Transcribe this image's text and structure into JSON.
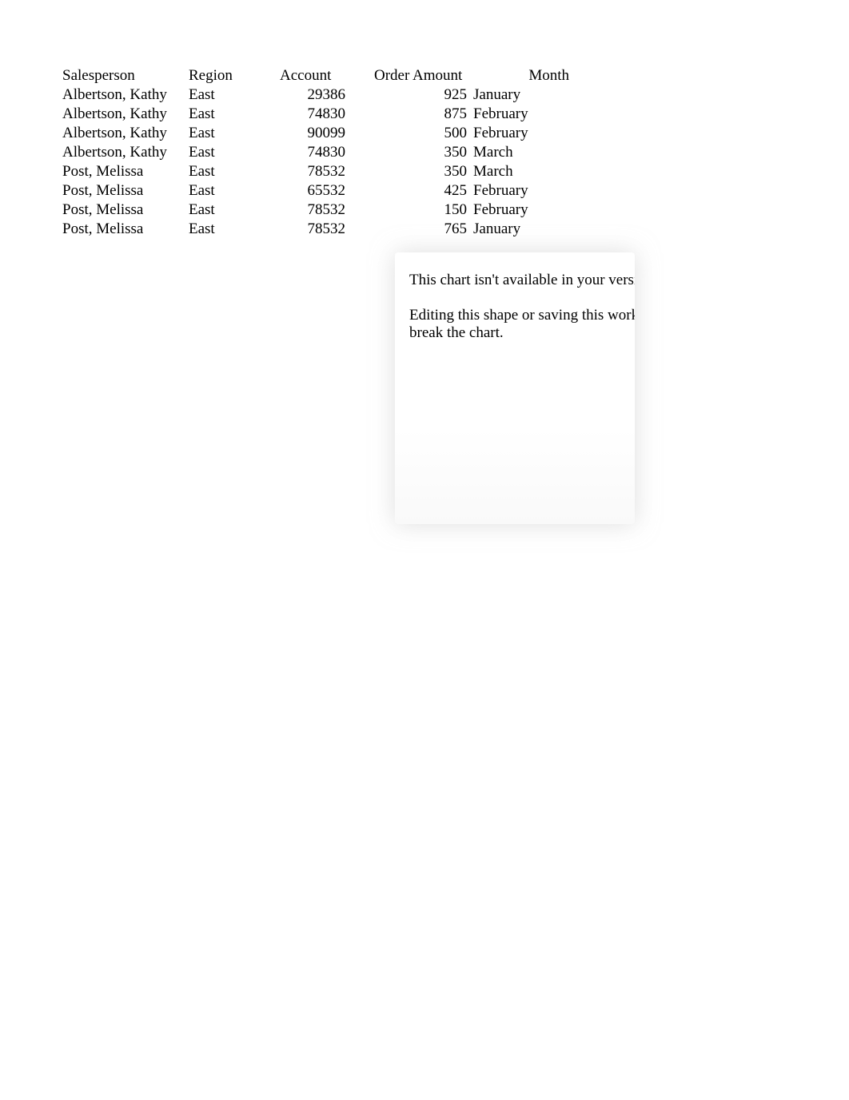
{
  "table": {
    "headers": {
      "salesperson": "Salesperson",
      "region": "Region",
      "account": "Account",
      "order_amount": "Order Amount",
      "month": "Month"
    },
    "rows": [
      {
        "salesperson": "Albertson, Kathy",
        "region": "East",
        "account": "29386",
        "order_amount": "925",
        "month": "January"
      },
      {
        "salesperson": "Albertson, Kathy",
        "region": "East",
        "account": "74830",
        "order_amount": "875",
        "month": "February"
      },
      {
        "salesperson": "Albertson, Kathy",
        "region": "East",
        "account": "90099",
        "order_amount": "500",
        "month": "February"
      },
      {
        "salesperson": "Albertson, Kathy",
        "region": "East",
        "account": "74830",
        "order_amount": "350",
        "month": "March"
      },
      {
        "salesperson": "Post, Melissa",
        "region": "East",
        "account": "78532",
        "order_amount": "350",
        "month": "March"
      },
      {
        "salesperson": "Post, Melissa",
        "region": "East",
        "account": "65532",
        "order_amount": "425",
        "month": "February"
      },
      {
        "salesperson": "Post, Melissa",
        "region": "East",
        "account": "78532",
        "order_amount": "150",
        "month": "February"
      },
      {
        "salesperson": "Post, Melissa",
        "region": "East",
        "account": "78532",
        "order_amount": "765",
        "month": "January"
      }
    ]
  },
  "notice": {
    "line1": "This chart isn't available in your versi",
    "line2": "Editing this shape or saving this work",
    "line3": "break the chart."
  },
  "chart_data": {
    "type": "table",
    "columns": [
      "Salesperson",
      "Region",
      "Account",
      "Order Amount",
      "Month"
    ],
    "rows": [
      [
        "Albertson, Kathy",
        "East",
        29386,
        925,
        "January"
      ],
      [
        "Albertson, Kathy",
        "East",
        74830,
        875,
        "February"
      ],
      [
        "Albertson, Kathy",
        "East",
        90099,
        500,
        "February"
      ],
      [
        "Albertson, Kathy",
        "East",
        74830,
        350,
        "March"
      ],
      [
        "Post, Melissa",
        "East",
        78532,
        350,
        "March"
      ],
      [
        "Post, Melissa",
        "East",
        65532,
        425,
        "February"
      ],
      [
        "Post, Melissa",
        "East",
        78532,
        150,
        "February"
      ],
      [
        "Post, Melissa",
        "East",
        78532,
        765,
        "January"
      ]
    ]
  }
}
